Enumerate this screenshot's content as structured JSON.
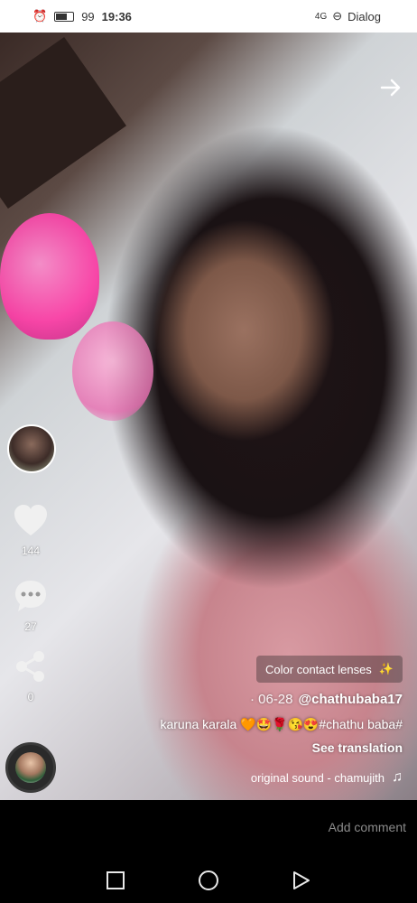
{
  "status_bar": {
    "time": "19:36",
    "app_name": "Dialog",
    "network": "4G",
    "battery_label": "99"
  },
  "video": {
    "like_count": "144",
    "comment_count": "27",
    "share_count": "0",
    "effect_label": "Color contact lenses",
    "username": "@chathubaba17",
    "date": "· 06-28",
    "caption": "karuna karala 🧡🤩🌹😘😍#chathu baba#",
    "translation_label": "See translation",
    "sound": "original sound - chamujith"
  },
  "footer": {
    "add_comment_placeholder": "Add comment"
  },
  "icons": [
    "back-arrow-icon",
    "heart-icon",
    "comment-icon",
    "share-icon",
    "music-note-icon",
    "effect-wand-icon",
    "square-nav-icon",
    "circle-nav-icon",
    "triangle-nav-icon"
  ]
}
